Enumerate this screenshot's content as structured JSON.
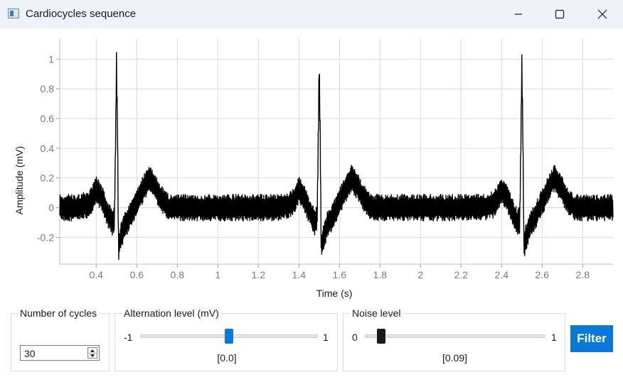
{
  "window": {
    "title": "Cardiocycles sequence",
    "icon": "app-icon",
    "controls": [
      "minimize-icon",
      "maximize-icon",
      "close-icon"
    ]
  },
  "chart_data": {
    "type": "line",
    "title": "",
    "xlabel": "Time (s)",
    "ylabel": "Amplitude (mV)",
    "xlim": [
      0.22,
      2.95
    ],
    "ylim": [
      -0.38,
      1.14
    ],
    "x_ticks": [
      "0.4",
      "0.6",
      "0.8",
      "1",
      "1.2",
      "1.4",
      "1.6",
      "1.8",
      "2",
      "2.2",
      "2.4",
      "2.6",
      "2.8"
    ],
    "y_ticks": [
      "1",
      "0.8",
      "0.6",
      "0.4",
      "0.2",
      "0",
      "-0.2"
    ],
    "grid": true,
    "legend": "none",
    "line_color": "#000000",
    "noise_band_mV": 0.09,
    "series": [
      {
        "x": [
          0.22,
          0.3,
          0.36,
          0.38,
          0.4,
          0.42,
          0.44,
          0.46,
          0.48,
          0.49,
          0.495,
          0.5,
          0.505,
          0.51,
          0.52,
          0.54,
          0.57,
          0.6,
          0.63,
          0.66,
          0.69,
          0.72,
          0.76,
          0.8,
          0.9,
          1.0,
          1.1,
          1.2,
          1.3,
          1.36,
          1.38,
          1.4,
          1.42,
          1.44,
          1.46,
          1.48,
          1.49,
          1.495,
          1.5,
          1.505,
          1.51,
          1.52,
          1.54,
          1.57,
          1.6,
          1.63,
          1.66,
          1.69,
          1.72,
          1.76,
          1.8,
          1.9,
          2.0,
          2.1,
          2.2,
          2.3,
          2.36,
          2.38,
          2.4,
          2.42,
          2.44,
          2.46,
          2.48,
          2.49,
          2.495,
          2.5,
          2.505,
          2.51,
          2.52,
          2.54,
          2.57,
          2.6,
          2.63,
          2.66,
          2.69,
          2.72,
          2.76,
          2.8,
          2.95
        ],
        "y": [
          0,
          0,
          0.02,
          0.06,
          0.12,
          0.08,
          0.02,
          -0.05,
          -0.1,
          -0.08,
          0.4,
          0.98,
          0.5,
          -0.28,
          -0.2,
          -0.12,
          -0.05,
          0.04,
          0.12,
          0.2,
          0.14,
          0.06,
          0,
          0,
          0,
          0,
          0,
          0,
          0,
          0.02,
          0.06,
          0.12,
          0.08,
          0.02,
          -0.05,
          -0.1,
          -0.08,
          0.4,
          0.98,
          0.5,
          -0.26,
          -0.2,
          -0.12,
          -0.05,
          0.04,
          0.12,
          0.2,
          0.14,
          0.06,
          0,
          0,
          0,
          0,
          0,
          0,
          0,
          0.02,
          0.06,
          0.12,
          0.08,
          0.02,
          -0.05,
          -0.1,
          -0.08,
          0.4,
          0.98,
          0.5,
          -0.26,
          -0.2,
          -0.12,
          -0.05,
          0.04,
          0.12,
          0.2,
          0.14,
          0.06,
          0,
          0,
          0
        ]
      }
    ]
  },
  "controls": {
    "cycles": {
      "label": "Number of cycles",
      "value": "30"
    },
    "alternation": {
      "label": "Alternation level (mV)",
      "min": "-1",
      "max": "1",
      "value_text": "[0.0]",
      "value": 0.0,
      "thumb_color": "#0a78d6"
    },
    "noise": {
      "label": "Noise level",
      "min": "0",
      "max": "1",
      "value_text": "[0.09]",
      "value": 0.09,
      "thumb_color": "#1a1a1a"
    },
    "filter_label": "Filter",
    "accent": "#0a78d6"
  }
}
